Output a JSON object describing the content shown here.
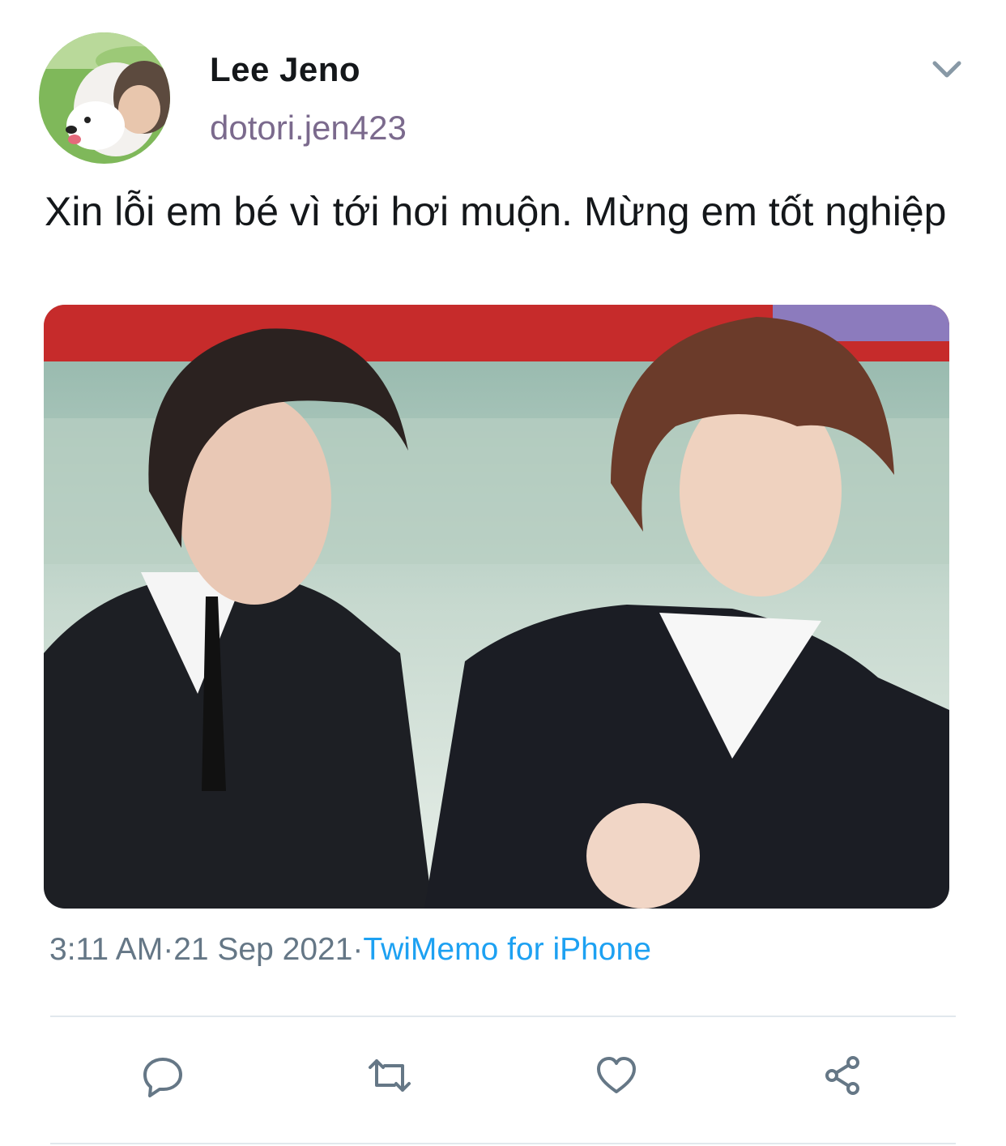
{
  "user": {
    "display_name": "Lee Jeno",
    "handle": "dotori.jen423"
  },
  "tweet": {
    "text": "Xin lỗi em bé vì tới hơi muộn. Mừng em tốt nghiệp",
    "time": "3:11 AM",
    "date": "21 Sep 2021",
    "separator": "·",
    "source": "TwiMemo for iPhone"
  },
  "actions": [
    {
      "icon": "reply-icon"
    },
    {
      "icon": "retweet-icon"
    },
    {
      "icon": "like-icon"
    },
    {
      "icon": "share-icon"
    }
  ],
  "colors": {
    "text": "#14171a",
    "handle": "#7b6a8d",
    "meta": "#657786",
    "link": "#1da1f2",
    "icon": "#657786",
    "divider": "#e1e8ed"
  }
}
